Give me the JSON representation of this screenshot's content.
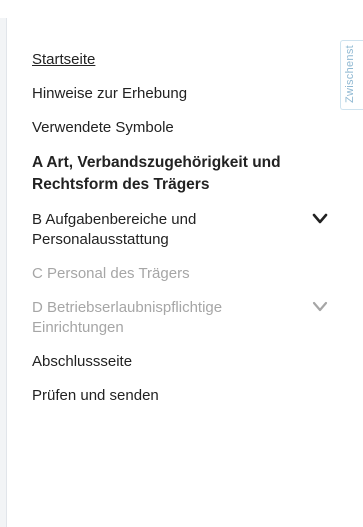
{
  "sidebar": {
    "items": [
      {
        "label": "Startseite"
      },
      {
        "label": "Hinweise zur Erhebung"
      },
      {
        "label": "Verwendete Symbole"
      },
      {
        "label": "A Art, Verbandszugehörigkeit und Rechtsform des Trägers"
      },
      {
        "label": "B Aufgabenbereiche und Personalausstattung",
        "icon": "chevron-down-icon"
      },
      {
        "label": "C Personal des Trägers"
      },
      {
        "label": "D Betriebserlaubnispflichtige Einrichtungen",
        "icon": "chevron-down-icon"
      },
      {
        "label": "Abschlussseite"
      },
      {
        "label": "Prüfen und senden"
      }
    ]
  },
  "side_tab": {
    "label": "Zwischenst"
  },
  "colors": {
    "text": "#222222",
    "disabled": "#a6a6a6",
    "side_tab_text": "#8fb8d2"
  }
}
